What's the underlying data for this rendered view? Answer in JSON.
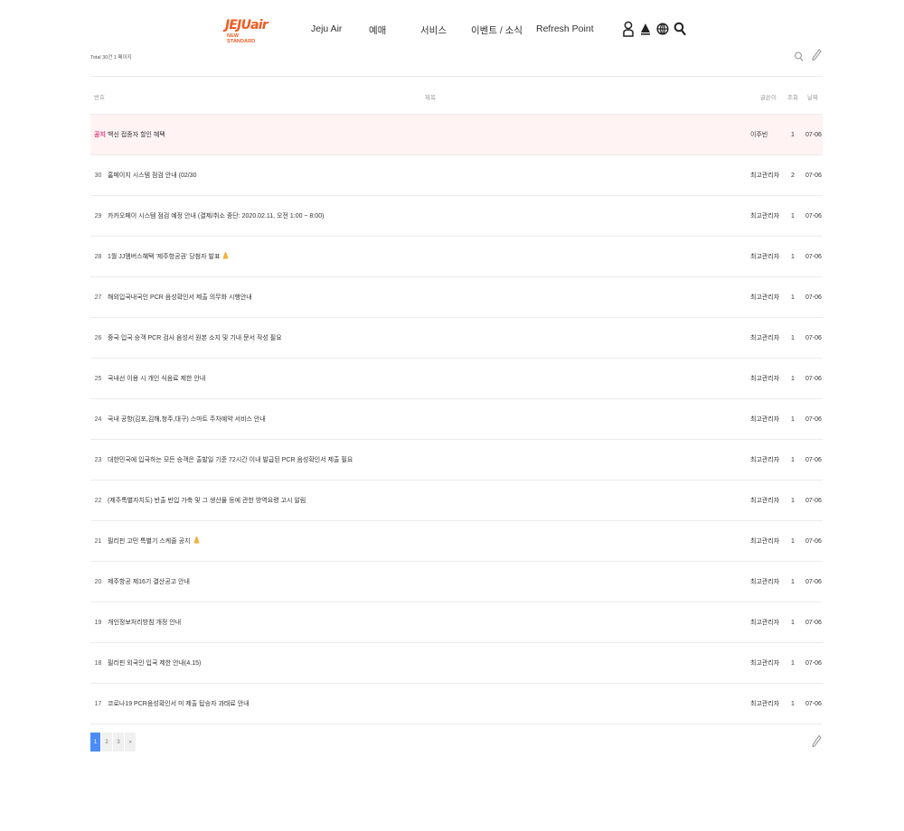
{
  "brand": {
    "logo_text": "JEJUair",
    "logo_sub": "NEW STANDARD",
    "color": "#f05a22"
  },
  "nav": {
    "items": [
      "Jeju Air",
      "예매",
      "서비스",
      "이벤트 / 소식",
      "Refresh Point"
    ],
    "icons": [
      "user-icon",
      "notification-icon",
      "globe-icon",
      "search-icon"
    ]
  },
  "board": {
    "total_label": "Total 30건 1 페이지",
    "headers": {
      "num": "번호",
      "title": "제목",
      "writer": "글쓴이",
      "hits": "조회",
      "date": "날짜"
    },
    "notice": {
      "label": "공지",
      "title": "백신 접종자 할인 혜택",
      "writer": "이주빈",
      "hits": "1",
      "date": "07-06"
    },
    "rows": [
      {
        "num": "30",
        "title": "홈페이지 시스템 점검 안내 (02/30",
        "writer": "최고관리자",
        "hits": "2",
        "date": "07-06",
        "emoji": false
      },
      {
        "num": "29",
        "title": "카카오페이 시스템 점검 예정 안내 (결제/취소 중단: 2020.02.11, 오전 1:00 ~ 8:00)",
        "writer": "최고관리자",
        "hits": "1",
        "date": "07-06",
        "emoji": false
      },
      {
        "num": "28",
        "title": "1월 JJ멤버스혜택 '제주항공권' 당첨자 발표",
        "writer": "최고관리자",
        "hits": "1",
        "date": "07-06",
        "emoji": true
      },
      {
        "num": "27",
        "title": "해외입국내국인 PCR 음성확인서 제출 의무화 시행안내",
        "writer": "최고관리자",
        "hits": "1",
        "date": "07-06",
        "emoji": false
      },
      {
        "num": "26",
        "title": "중국 입국 승객 PCR 검사 음성서 원본 소지 및 기내 문서 작성 필요",
        "writer": "최고관리자",
        "hits": "1",
        "date": "07-06",
        "emoji": false
      },
      {
        "num": "25",
        "title": "국내선 이용 시 개인 식음료 제한 안내",
        "writer": "최고관리자",
        "hits": "1",
        "date": "07-06",
        "emoji": false
      },
      {
        "num": "24",
        "title": "국내 공항(김포,김해,청주,대구) 스마트 주차예약 서비스 안내",
        "writer": "최고관리자",
        "hits": "1",
        "date": "07-06",
        "emoji": false
      },
      {
        "num": "23",
        "title": "대한민국에 입국하는 모든 승객은 출발일 기준 72시간 이내 발급된 PCR 음성확인서 제출 필요",
        "writer": "최고관리자",
        "hits": "1",
        "date": "07-06",
        "emoji": false
      },
      {
        "num": "22",
        "title": "(제주특별자치도) 반출    반입 가축 및 그 생산물 등에 관한 방역요령 고시 알림",
        "writer": "최고관리자",
        "hits": "1",
        "date": "07-06",
        "emoji": false
      },
      {
        "num": "21",
        "title": "필리핀 고민 특별기 스케줄 공지",
        "writer": "최고관리자",
        "hits": "1",
        "date": "07-06",
        "emoji": true
      },
      {
        "num": "20",
        "title": "제주항공 제16기 결산공고 안내",
        "writer": "최고관리자",
        "hits": "1",
        "date": "07-06",
        "emoji": false
      },
      {
        "num": "19",
        "title": "개인정보처리방침 개정 안내",
        "writer": "최고관리자",
        "hits": "1",
        "date": "07-06",
        "emoji": false
      },
      {
        "num": "18",
        "title": "필리핀 외국인 입국 제한 안내(4.15)",
        "writer": "최고관리자",
        "hits": "1",
        "date": "07-06",
        "emoji": false
      },
      {
        "num": "17",
        "title": "코로나19 PCR음성확인서 미 제출 탑승자 과태료 안내",
        "writer": "최고관리자",
        "hits": "1",
        "date": "07-06",
        "emoji": false
      }
    ],
    "notice_color": "#e5397a"
  },
  "pagination": {
    "pages": [
      "1",
      "2",
      "3"
    ],
    "next": "»",
    "current": "1",
    "active_color": "#4b8df8"
  }
}
